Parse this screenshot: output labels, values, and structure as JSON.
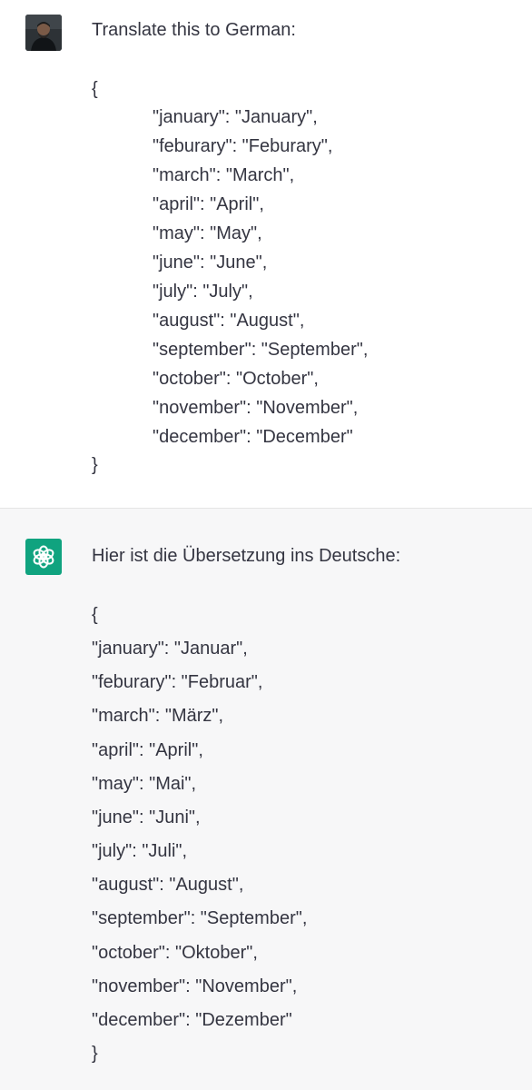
{
  "user_message": {
    "intro": "Translate this to German:",
    "open_brace": "{",
    "lines": [
      "\"january\": \"January\",",
      "\"feburary\": \"Feburary\",",
      "\"march\": \"March\",",
      "\"april\": \"April\",",
      "\"may\": \"May\",",
      "\"june\": \"June\",",
      "\"july\": \"July\",",
      "\"august\": \"August\",",
      "\"september\": \"September\",",
      "\"october\": \"October\",",
      "\"november\": \"November\",",
      "\"december\": \"December\""
    ],
    "close_brace": "}"
  },
  "assistant_message": {
    "intro": "Hier ist die Übersetzung ins Deutsche:",
    "open_brace": "{",
    "lines": [
      "\"january\": \"Januar\",",
      "\"feburary\": \"Februar\",",
      "\"march\": \"März\",",
      "\"april\": \"April\",",
      "\"may\": \"Mai\",",
      "\"june\": \"Juni\",",
      "\"july\": \"Juli\",",
      "\"august\": \"August\",",
      "\"september\": \"September\",",
      "\"october\": \"Oktober\",",
      "\"november\": \"November\",",
      "\"december\": \"Dezember\""
    ],
    "close_brace": "}"
  },
  "colors": {
    "assistant_bg": "#f7f7f8",
    "assistant_avatar": "#10a37f",
    "text": "#343541"
  }
}
